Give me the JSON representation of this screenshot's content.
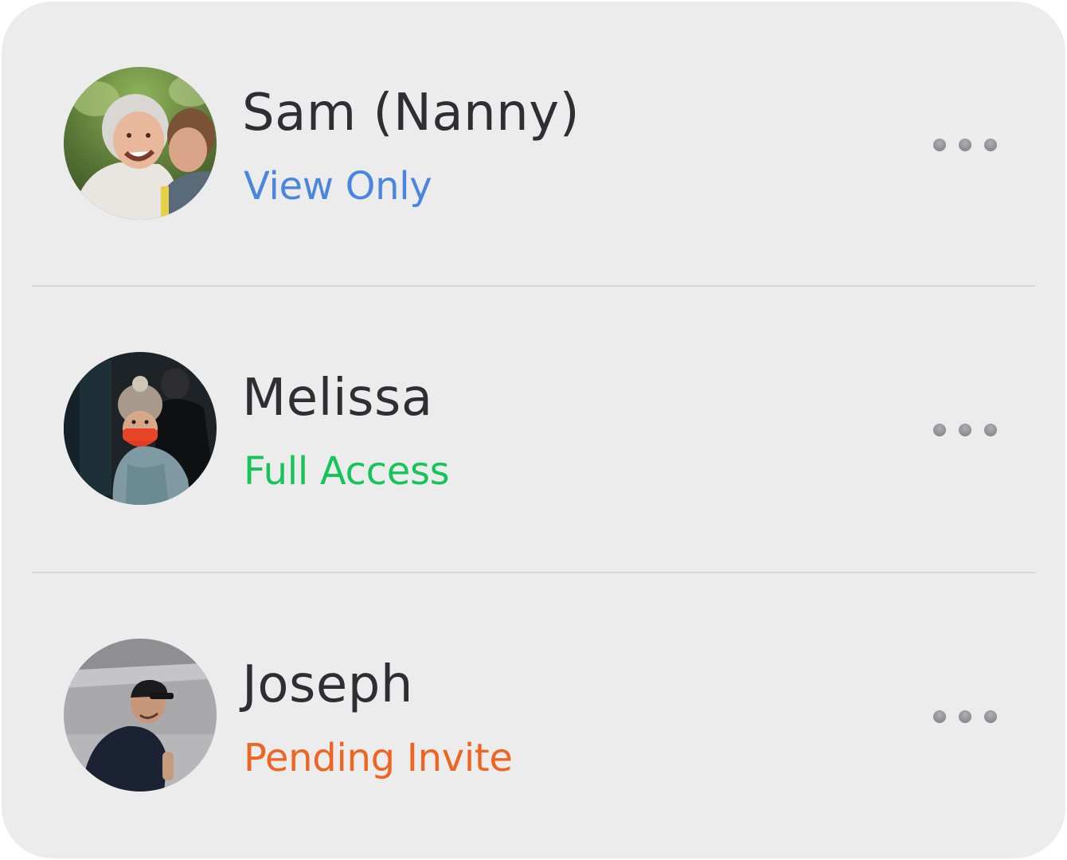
{
  "members": [
    {
      "name": "Sam (Nanny)",
      "access": "View Only",
      "access_color": "#4a86dd",
      "avatar_icon": "avatar-photo-elderly-woman-with-boy",
      "more_icon": "more-horizontal-icon"
    },
    {
      "name": "Melissa",
      "access": "Full Access",
      "access_color": "#16c45a",
      "avatar_icon": "avatar-photo-woman-in-beanie-and-red-mask",
      "more_icon": "more-horizontal-icon"
    },
    {
      "name": "Joseph",
      "access": "Pending Invite",
      "access_color": "#ee6522",
      "avatar_icon": "avatar-photo-man-in-cap",
      "more_icon": "more-horizontal-icon"
    }
  ]
}
